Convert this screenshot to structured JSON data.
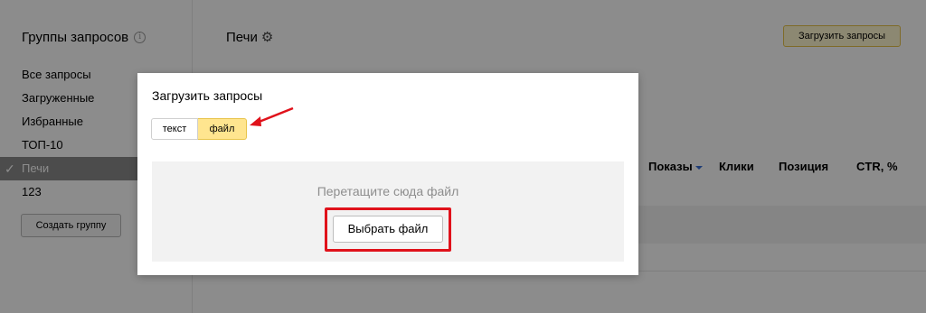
{
  "sidebar": {
    "title": "Группы запросов",
    "info_icon": "i",
    "items": [
      {
        "label": "Все запросы",
        "active": false
      },
      {
        "label": "Загруженные",
        "active": false
      },
      {
        "label": "Избранные",
        "active": false
      },
      {
        "label": "ТОП-10",
        "active": false
      },
      {
        "label": "Печи",
        "active": true
      },
      {
        "label": "123",
        "active": false
      }
    ],
    "check_mark": "✓",
    "create_group_label": "Создать группу"
  },
  "main": {
    "title": "Печи",
    "gear_icon": "⚙",
    "upload_button_label": "Загрузить запросы",
    "columns": [
      "Показы",
      "Клики",
      "Позиция",
      "CTR, %"
    ]
  },
  "modal": {
    "title": "Загрузить запросы",
    "tabs": [
      "текст",
      "файл"
    ],
    "selected_tab": "файл",
    "drop_text": "Перетащите сюда файл",
    "choose_file_label": "Выбрать файл"
  },
  "colors": {
    "accent_yellow": "#ffe58f",
    "highlight_red": "#e0121b",
    "sort_arrow_blue": "#3a6fd8"
  }
}
